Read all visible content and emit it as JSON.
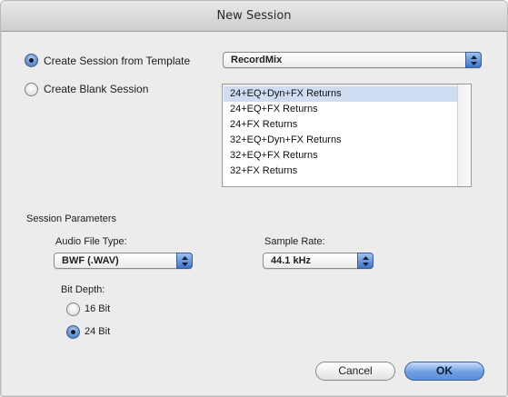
{
  "window": {
    "title": "New Session"
  },
  "source": {
    "template_option": {
      "label": "Create Session from Template",
      "selected": true
    },
    "blank_option": {
      "label": "Create Blank Session",
      "selected": false
    },
    "template_group": {
      "value": "RecordMix"
    },
    "templates": [
      {
        "label": "24+EQ+Dyn+FX Returns",
        "selected": true
      },
      {
        "label": "24+EQ+FX Returns",
        "selected": false
      },
      {
        "label": "24+FX Returns",
        "selected": false
      },
      {
        "label": "32+EQ+Dyn+FX Returns",
        "selected": false
      },
      {
        "label": "32+EQ+FX Returns",
        "selected": false
      },
      {
        "label": "32+FX Returns",
        "selected": false
      }
    ]
  },
  "parameters": {
    "heading": "Session Parameters",
    "audio_file_type": {
      "label": "Audio File Type:",
      "value": "BWF (.WAV)"
    },
    "sample_rate": {
      "label": "Sample Rate:",
      "value": "44.1 kHz"
    },
    "bit_depth": {
      "label": "Bit Depth:",
      "options": [
        {
          "label": "16 Bit",
          "selected": false
        },
        {
          "label": "24 Bit",
          "selected": true
        }
      ]
    }
  },
  "buttons": {
    "cancel": "Cancel",
    "ok": "OK"
  }
}
